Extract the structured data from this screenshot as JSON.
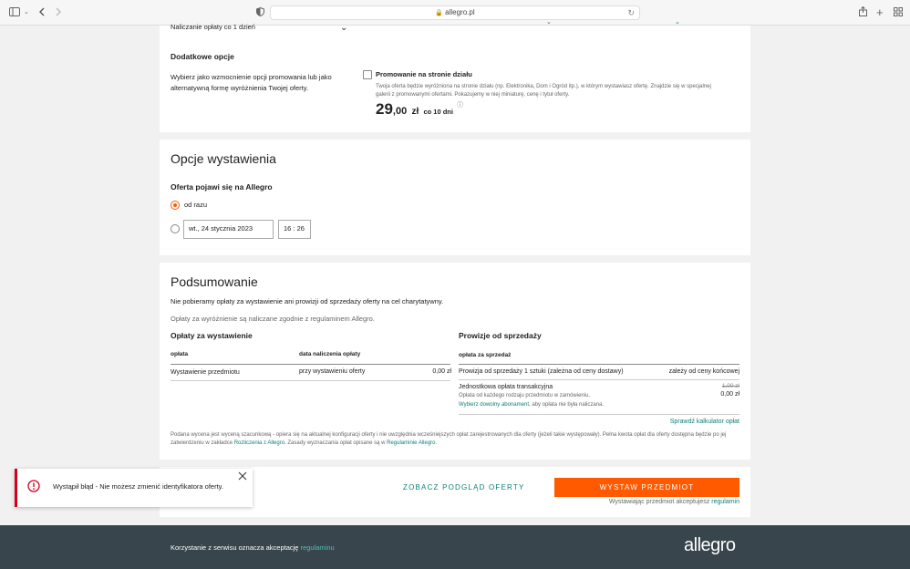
{
  "browser": {
    "url": "allegro.pl"
  },
  "promo": {
    "billing_select": "Naliczanie opłaty co 1 dzień",
    "section_title": "Dodatkowe opcje",
    "description": "Wybierz jako wzmocnienie opcji promowania lub jako alternatywną formę wyróżnienia Twojej oferty.",
    "option_title": "Promowanie na stronie działu",
    "option_desc": "Twoja oferta będzie wyróżniona na stronie działu (np. Elektronika, Dom i Ogród itp.), w którym wystawiasz ofertę. Znajdzie się w specjalnej galerii z promowanymi ofertami. Pokazujemy w niej miniaturę, cenę i tytuł oferty.",
    "price_int": "29",
    "price_dec": ",00",
    "price_cur": "zł",
    "price_period": "co 10 dni"
  },
  "listing": {
    "title": "Opcje wystawienia",
    "subtitle": "Oferta pojawi się na Allegro",
    "option_now": "od razu",
    "date_value": "wt., 24 stycznia 2023",
    "time_value": "16 : 26"
  },
  "summary": {
    "title": "Podsumowanie",
    "line1": "Nie pobieramy opłaty za wystawienie ani prowizji od sprzedaży oferty na cel charytatywny.",
    "line2": "Opłaty za wyróżnienie są naliczane zgodnie z regulaminem Allegro.",
    "fees_title": "Opłaty za wystawienie",
    "fees_headers": {
      "col1": "opłata",
      "col2": "data naliczenia opłaty"
    },
    "fees_row": {
      "name": "Wystawienie przedmiotu",
      "when": "przy wystawieniu oferty",
      "amount": "0,00 zł"
    },
    "commission_title": "Prowizje od sprzedaży",
    "commission_header": "opłata za sprzedaż",
    "commission_row": {
      "name": "Prowizja od sprzedaży 1 sztuki (zależna od ceny dostawy)",
      "value": "zależy od ceny końcowej"
    },
    "transaction": {
      "name": "Jednostkowa opłata transakcyjna",
      "desc": "Opłata od każdego rodzaju przedmiotu w zamówieniu.",
      "link": "Wybierz dowolny abonament",
      "link_suffix": ", aby opłata nie była naliczana.",
      "old_price": "1,00 zł",
      "new_price": "0,00 zł"
    },
    "calculator_link": "Sprawdź kalkulator opłat",
    "footnote_part1": "Podana wycena jest wyceną szacunkową - opiera się na aktualnej konfiguracji oferty i nie uwzględnia wcześniejszych opłat zarejestrowanych dla oferty (jeżeli takie występowały). Pełna kwota opłat dla oferty dostępna będzie po jej zatwierdzeniu w zakładce ",
    "footnote_link1": "Rozliczenia z Allegro",
    "footnote_part2": ". Zasady wyznaczania opłat opisane są w ",
    "footnote_link2": "Regulaminie Allegro",
    "footnote_part3": "."
  },
  "actions": {
    "preview": "ZOBACZ PODGLĄD OFERTY",
    "submit": "WYSTAW PRZEDMIOT",
    "accept_text": "Wystawiając przedmiot akceptujesz",
    "accept_link": "regulamin"
  },
  "footer": {
    "text": "Korzystanie z serwisu oznacza akceptację",
    "link": "regulaminu",
    "logo": "allegro"
  },
  "toast": {
    "message": "Wystąpił błąd - Nie możesz zmienić identyfikatora oferty."
  },
  "colors": {
    "accent": "#ff5a00",
    "teal": "#0b7f76",
    "error": "#d0021b",
    "footer_bg": "#38454c"
  }
}
